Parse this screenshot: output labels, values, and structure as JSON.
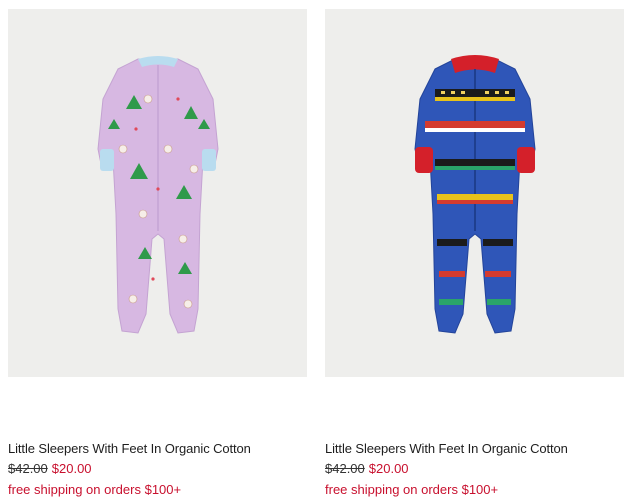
{
  "products": [
    {
      "name": "Little Sleepers With Feet In Organic Cotton",
      "original_price": "$42.00",
      "sale_price": "$20.00",
      "promo": "free shipping on orders $100+",
      "image": "lavender-footed-sleeper-with-holiday-print",
      "colors": {
        "body": "#d7b8e2",
        "trim": "#b9dcef"
      }
    },
    {
      "name": "Little Sleepers With Feet In Organic Cotton",
      "original_price": "$42.00",
      "sale_price": "$20.00",
      "promo": "free shipping on orders $100+",
      "image": "blue-footed-sleeper-with-train-print",
      "colors": {
        "body": "#2f56b8",
        "trim": "#d4202a"
      }
    }
  ],
  "colors": {
    "sale": "#c8102e",
    "image_bg": "#eeeeec"
  }
}
